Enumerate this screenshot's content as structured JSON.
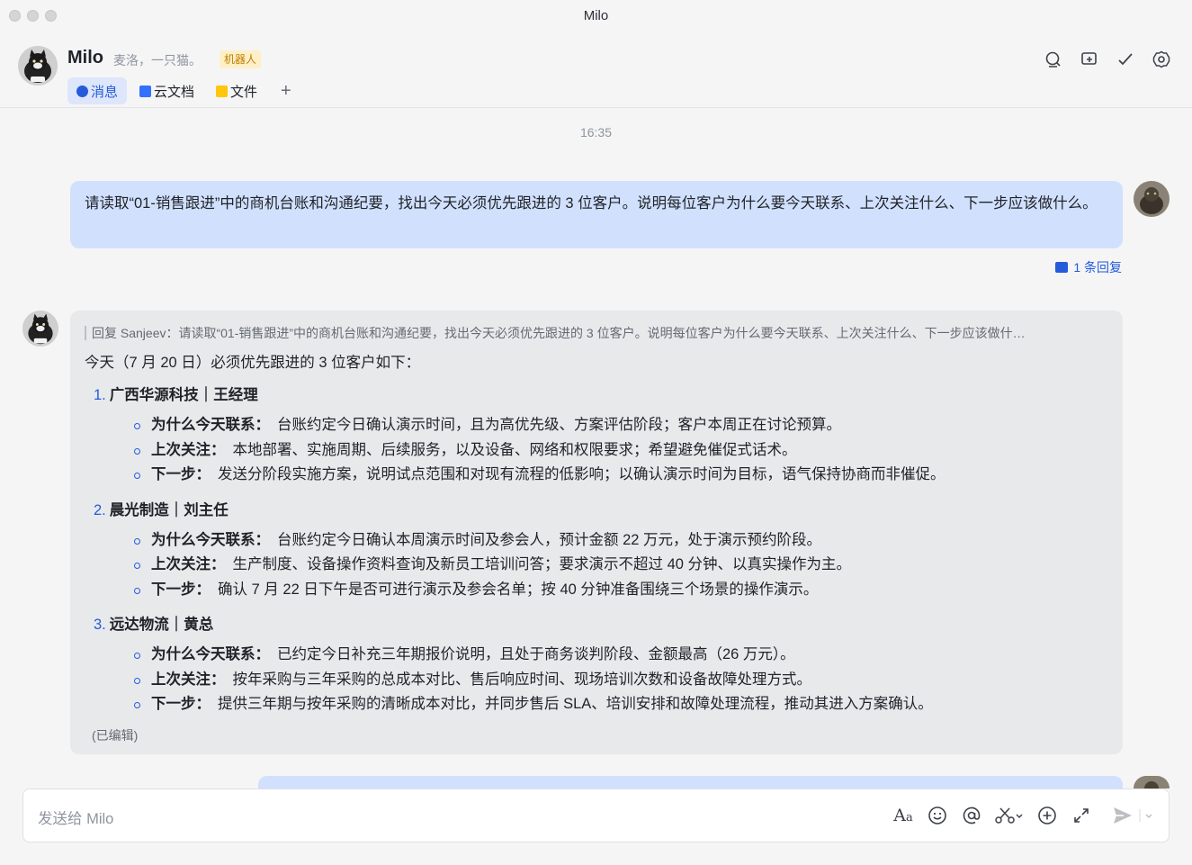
{
  "window": {
    "title": "Milo"
  },
  "header": {
    "name": "Milo",
    "signature": "麦洛，一只猫。",
    "badge": "机器人",
    "tabs": [
      {
        "label": "消息",
        "icon": "chat-bubble-icon",
        "active": true
      },
      {
        "label": "云文档",
        "icon": "document-icon",
        "active": false
      },
      {
        "label": "文件",
        "icon": "folder-icon",
        "active": false
      }
    ],
    "add_tab": "+"
  },
  "timestamp": "16:35",
  "user_message": {
    "text": "请读取“01-销售跟进”中的商机台账和沟通纪要，找出今天必须优先跟进的 3 位客户。说明每位客户为什么要今天联系、上次关注什么、下一步应该做什么。"
  },
  "reply_count": "1 条回复",
  "bot_message": {
    "quote": "回复 Sanjeev：请读取“01-销售跟进”中的商机台账和沟通纪要，找出今天必须优先跟进的 3 位客户。说明每位客户为什么要今天联系、上次关注什么、下一步应该做什…",
    "intro": "今天（7 月 20 日）必须优先跟进的 3 位客户如下：",
    "sections": [
      {
        "num": "1.",
        "title": "广西华源科技｜王经理",
        "items": [
          {
            "label": "为什么今天联系：",
            "text": "台账约定今日确认演示时间，且为高优先级、方案评估阶段；客户本周正在讨论预算。"
          },
          {
            "label": "上次关注：",
            "text": "本地部署、实施周期、后续服务，以及设备、网络和权限要求；希望避免催促式话术。"
          },
          {
            "label": "下一步：",
            "text": "发送分阶段实施方案，说明试点范围和对现有流程的低影响；以确认演示时间为目标，语气保持协商而非催促。"
          }
        ]
      },
      {
        "num": "2.",
        "title": "晨光制造｜刘主任",
        "items": [
          {
            "label": "为什么今天联系：",
            "text": "台账约定今日确认本周演示时间及参会人，预计金额 22 万元，处于演示预约阶段。"
          },
          {
            "label": "上次关注：",
            "text": "生产制度、设备操作资料查询及新员工培训问答；要求演示不超过 40 分钟、以真实操作为主。"
          },
          {
            "label": "下一步：",
            "text": "确认 7 月 22 日下午是否可进行演示及参会名单；按 40 分钟准备围绕三个场景的操作演示。"
          }
        ]
      },
      {
        "num": "3.",
        "title": "远达物流｜黄总",
        "items": [
          {
            "label": "为什么今天联系：",
            "text": "已约定今日补充三年期报价说明，且处于商务谈判阶段、金额最高（26 万元）。"
          },
          {
            "label": "上次关注：",
            "text": "按年采购与三年采购的总成本对比、售后响应时间、现场培训次数和设备故障处理方式。"
          },
          {
            "label": "下一步：",
            "text": "提供三年期与按年采购的清晰成本对比，并同步售后 SLA、培训安排和故障处理流程，推动其进入方案确认。"
          }
        ]
      }
    ],
    "edited": "(已编辑)"
  },
  "input": {
    "placeholder": "发送给 Milo"
  },
  "colors": {
    "accent": "#245bdb",
    "user_bubble": "#d1e0fd",
    "bot_bubble": "#e8e9eb",
    "badge_bg": "#fdf0c7"
  }
}
